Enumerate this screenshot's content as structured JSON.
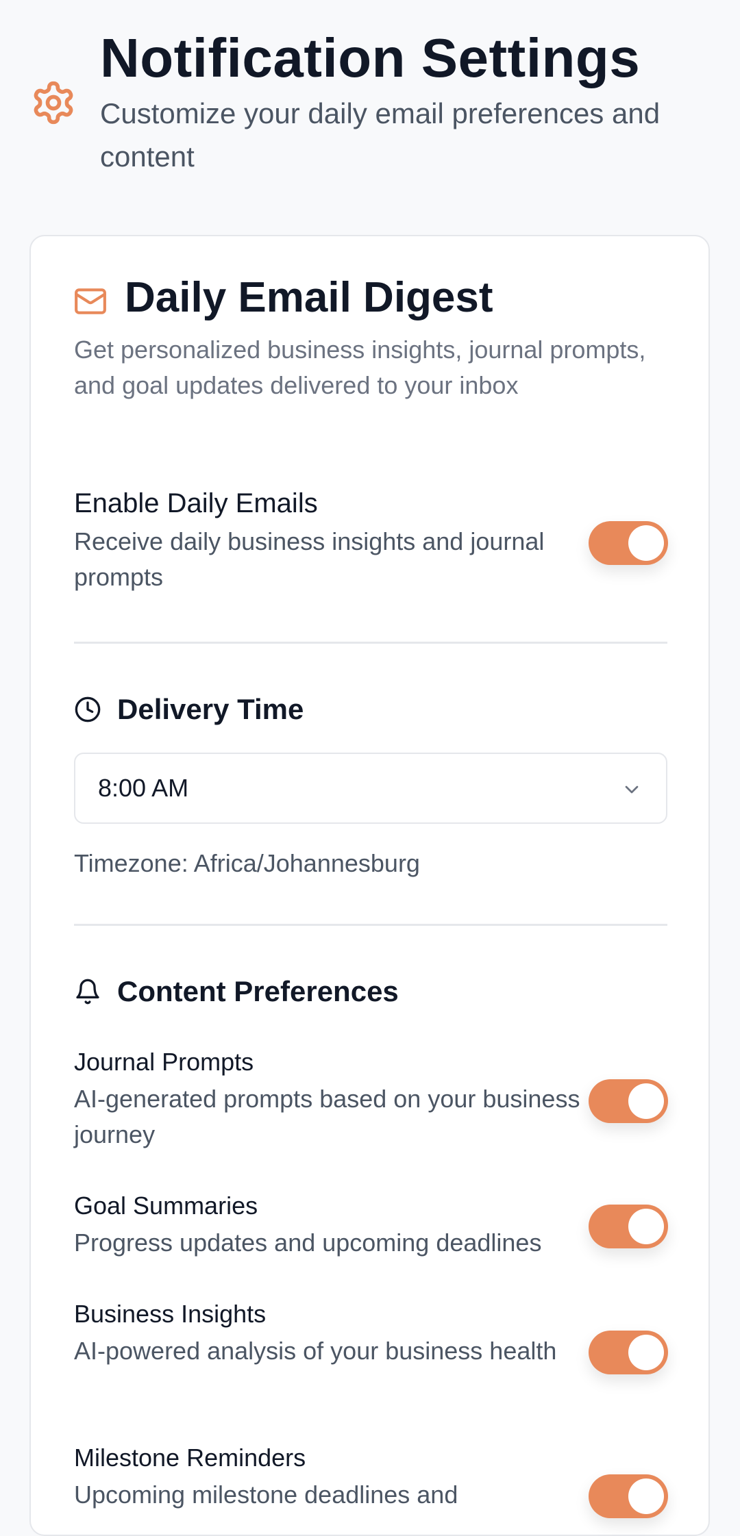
{
  "header": {
    "title": "Notification Settings",
    "subtitle": "Customize your daily email preferences and content",
    "icon": "gear-icon"
  },
  "card": {
    "title": "Daily Email Digest",
    "description": "Get personalized business insights, journal prompts, and goal updates delivered to your inbox",
    "icon": "mail-icon"
  },
  "enable_daily": {
    "title": "Enable Daily Emails",
    "description": "Receive daily business insights and journal prompts",
    "enabled": true
  },
  "delivery": {
    "title": "Delivery Time",
    "icon": "clock-icon",
    "selected_time": "8:00 AM",
    "timezone_text": "Timezone: Africa/Johannesburg"
  },
  "content_preferences": {
    "title": "Content Preferences",
    "icon": "bell-icon",
    "items": [
      {
        "title": "Journal Prompts",
        "description": "AI-generated prompts based on your business journey",
        "enabled": true
      },
      {
        "title": "Goal Summaries",
        "description": "Progress updates and upcoming deadlines",
        "enabled": true
      },
      {
        "title": "Business Insights",
        "description": "AI-powered analysis of your business health",
        "enabled": true
      },
      {
        "title": "Milestone Reminders",
        "description": "Upcoming milestone deadlines and",
        "enabled": true
      }
    ]
  },
  "colors": {
    "accent": "#e8895a",
    "text_primary": "#111827",
    "text_secondary": "#4b5563",
    "muted": "#6b7280",
    "background": "#f8f9fb",
    "card": "#ffffff",
    "border": "#e5e7eb"
  }
}
